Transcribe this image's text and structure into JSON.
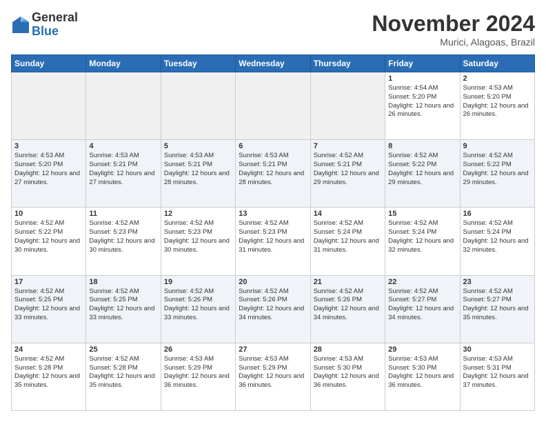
{
  "logo": {
    "general": "General",
    "blue": "Blue"
  },
  "header": {
    "month": "November 2024",
    "location": "Murici, Alagoas, Brazil"
  },
  "days_of_week": [
    "Sunday",
    "Monday",
    "Tuesday",
    "Wednesday",
    "Thursday",
    "Friday",
    "Saturday"
  ],
  "weeks": [
    [
      {
        "day": "",
        "info": ""
      },
      {
        "day": "",
        "info": ""
      },
      {
        "day": "",
        "info": ""
      },
      {
        "day": "",
        "info": ""
      },
      {
        "day": "",
        "info": ""
      },
      {
        "day": "1",
        "info": "Sunrise: 4:54 AM\nSunset: 5:20 PM\nDaylight: 12 hours and 26 minutes."
      },
      {
        "day": "2",
        "info": "Sunrise: 4:53 AM\nSunset: 5:20 PM\nDaylight: 12 hours and 26 minutes."
      }
    ],
    [
      {
        "day": "3",
        "info": "Sunrise: 4:53 AM\nSunset: 5:20 PM\nDaylight: 12 hours and 27 minutes."
      },
      {
        "day": "4",
        "info": "Sunrise: 4:53 AM\nSunset: 5:21 PM\nDaylight: 12 hours and 27 minutes."
      },
      {
        "day": "5",
        "info": "Sunrise: 4:53 AM\nSunset: 5:21 PM\nDaylight: 12 hours and 28 minutes."
      },
      {
        "day": "6",
        "info": "Sunrise: 4:53 AM\nSunset: 5:21 PM\nDaylight: 12 hours and 28 minutes."
      },
      {
        "day": "7",
        "info": "Sunrise: 4:52 AM\nSunset: 5:21 PM\nDaylight: 12 hours and 29 minutes."
      },
      {
        "day": "8",
        "info": "Sunrise: 4:52 AM\nSunset: 5:22 PM\nDaylight: 12 hours and 29 minutes."
      },
      {
        "day": "9",
        "info": "Sunrise: 4:52 AM\nSunset: 5:22 PM\nDaylight: 12 hours and 29 minutes."
      }
    ],
    [
      {
        "day": "10",
        "info": "Sunrise: 4:52 AM\nSunset: 5:22 PM\nDaylight: 12 hours and 30 minutes."
      },
      {
        "day": "11",
        "info": "Sunrise: 4:52 AM\nSunset: 5:23 PM\nDaylight: 12 hours and 30 minutes."
      },
      {
        "day": "12",
        "info": "Sunrise: 4:52 AM\nSunset: 5:23 PM\nDaylight: 12 hours and 30 minutes."
      },
      {
        "day": "13",
        "info": "Sunrise: 4:52 AM\nSunset: 5:23 PM\nDaylight: 12 hours and 31 minutes."
      },
      {
        "day": "14",
        "info": "Sunrise: 4:52 AM\nSunset: 5:24 PM\nDaylight: 12 hours and 31 minutes."
      },
      {
        "day": "15",
        "info": "Sunrise: 4:52 AM\nSunset: 5:24 PM\nDaylight: 12 hours and 32 minutes."
      },
      {
        "day": "16",
        "info": "Sunrise: 4:52 AM\nSunset: 5:24 PM\nDaylight: 12 hours and 32 minutes."
      }
    ],
    [
      {
        "day": "17",
        "info": "Sunrise: 4:52 AM\nSunset: 5:25 PM\nDaylight: 12 hours and 33 minutes."
      },
      {
        "day": "18",
        "info": "Sunrise: 4:52 AM\nSunset: 5:25 PM\nDaylight: 12 hours and 33 minutes."
      },
      {
        "day": "19",
        "info": "Sunrise: 4:52 AM\nSunset: 5:26 PM\nDaylight: 12 hours and 33 minutes."
      },
      {
        "day": "20",
        "info": "Sunrise: 4:52 AM\nSunset: 5:26 PM\nDaylight: 12 hours and 34 minutes."
      },
      {
        "day": "21",
        "info": "Sunrise: 4:52 AM\nSunset: 5:26 PM\nDaylight: 12 hours and 34 minutes."
      },
      {
        "day": "22",
        "info": "Sunrise: 4:52 AM\nSunset: 5:27 PM\nDaylight: 12 hours and 34 minutes."
      },
      {
        "day": "23",
        "info": "Sunrise: 4:52 AM\nSunset: 5:27 PM\nDaylight: 12 hours and 35 minutes."
      }
    ],
    [
      {
        "day": "24",
        "info": "Sunrise: 4:52 AM\nSunset: 5:28 PM\nDaylight: 12 hours and 35 minutes."
      },
      {
        "day": "25",
        "info": "Sunrise: 4:52 AM\nSunset: 5:28 PM\nDaylight: 12 hours and 35 minutes."
      },
      {
        "day": "26",
        "info": "Sunrise: 4:53 AM\nSunset: 5:29 PM\nDaylight: 12 hours and 36 minutes."
      },
      {
        "day": "27",
        "info": "Sunrise: 4:53 AM\nSunset: 5:29 PM\nDaylight: 12 hours and 36 minutes."
      },
      {
        "day": "28",
        "info": "Sunrise: 4:53 AM\nSunset: 5:30 PM\nDaylight: 12 hours and 36 minutes."
      },
      {
        "day": "29",
        "info": "Sunrise: 4:53 AM\nSunset: 5:30 PM\nDaylight: 12 hours and 36 minutes."
      },
      {
        "day": "30",
        "info": "Sunrise: 4:53 AM\nSunset: 5:31 PM\nDaylight: 12 hours and 37 minutes."
      }
    ]
  ]
}
